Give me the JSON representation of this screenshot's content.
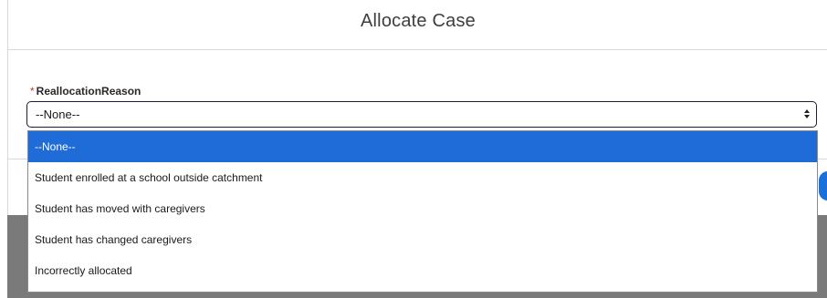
{
  "modal": {
    "title": "Allocate Case"
  },
  "field": {
    "required_marker": "*",
    "label": "ReallocationReason",
    "selected_value": "--None--"
  },
  "dropdown": {
    "options": [
      {
        "label": "--None--",
        "selected": true
      },
      {
        "label": "Student enrolled at a school outside catchment",
        "selected": false
      },
      {
        "label": "Student has moved with caregivers",
        "selected": false
      },
      {
        "label": "Student has changed caregivers",
        "selected": false
      },
      {
        "label": "Incorrectly allocated",
        "selected": false
      }
    ]
  },
  "colors": {
    "selected_highlight": "#1f6cd8",
    "required": "#c23934",
    "backdrop": "#7a7a7a"
  },
  "icons": {
    "select_arrows": "up-down-chevron-icon"
  }
}
